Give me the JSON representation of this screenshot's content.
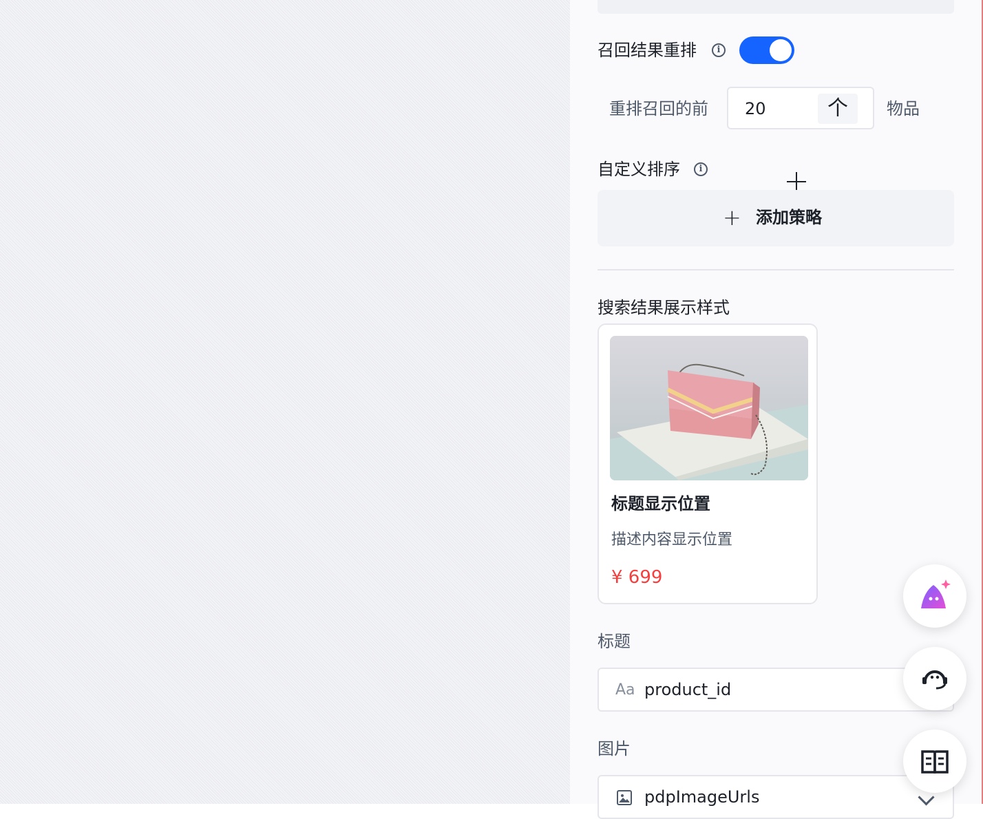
{
  "rerank": {
    "label": "召回结果重排",
    "info_icon": "info-icon",
    "enabled": true,
    "accent_color": "#1664ff",
    "top_prefix": "重排召回的前",
    "top_value": "20",
    "unit_char": "个",
    "top_suffix": "物品"
  },
  "custom_sort": {
    "label": "自定义排序",
    "info_icon": "info-icon",
    "add_icon": "plus-icon",
    "add_label": "添加策略"
  },
  "display_style": {
    "label": "搜索结果展示样式",
    "card": {
      "image": "pink-handbag-photo",
      "title": "标题显示位置",
      "description": "描述内容显示位置",
      "price": "¥ 699",
      "price_color": "#f53f3f"
    }
  },
  "title_field": {
    "label": "标题",
    "icon_text": "Aa",
    "value": "product_id"
  },
  "image_field": {
    "label": "图片",
    "icon": "image-icon",
    "value": "pdpImageUrls"
  },
  "floating_buttons": [
    "ai-assistant-icon",
    "support-headset-icon",
    "docs-book-icon"
  ]
}
